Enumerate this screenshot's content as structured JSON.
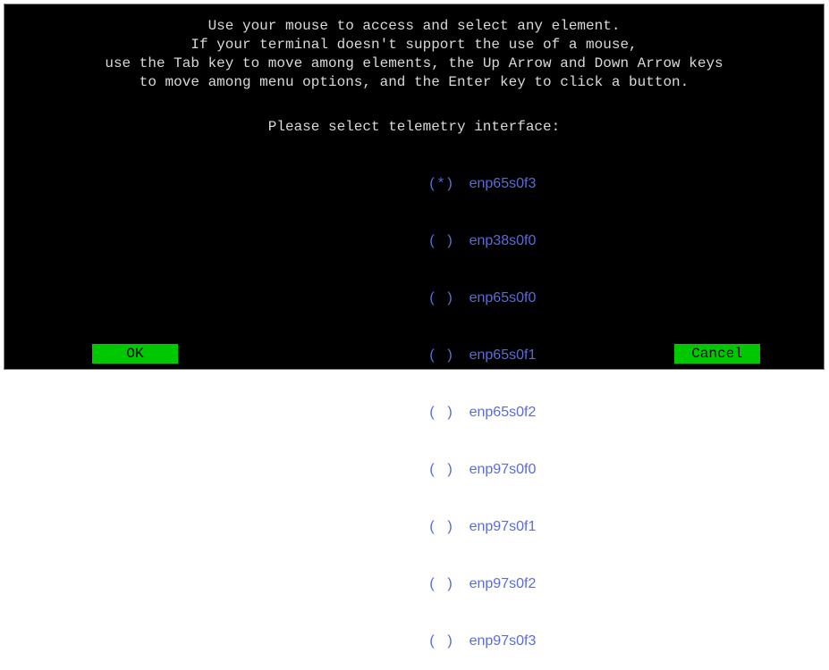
{
  "instructions": {
    "lines": [
      "Use your mouse to access and select any element.",
      "If your terminal doesn't support the use of a mouse,",
      "use the Tab key to move among elements, the Up Arrow and Down Arrow keys",
      "to move among menu options, and the Enter key to click a button."
    ]
  },
  "prompt": "Please select telemetry interface:",
  "options": [
    {
      "radio": "(*)",
      "label": "enp65s0f3",
      "selected": true
    },
    {
      "radio": "( )",
      "label": "enp38s0f0",
      "selected": false
    },
    {
      "radio": "( )",
      "label": "enp65s0f0",
      "selected": false
    },
    {
      "radio": "( )",
      "label": "enp65s0f1",
      "selected": false
    },
    {
      "radio": "( )",
      "label": "enp65s0f2",
      "selected": false
    },
    {
      "radio": "( )",
      "label": "enp97s0f0",
      "selected": false
    },
    {
      "radio": "( )",
      "label": "enp97s0f1",
      "selected": false
    },
    {
      "radio": "( )",
      "label": "enp97s0f2",
      "selected": false
    },
    {
      "radio": "( )",
      "label": "enp97s0f3",
      "selected": false
    }
  ],
  "buttons": {
    "ok_label": "OK",
    "cancel_label": "Cancel"
  },
  "colors": {
    "background": "#000000",
    "text": "#d9d9d9",
    "option_text": "#5b6bd8",
    "button_bg": "#00c800",
    "button_text": "#000000"
  }
}
